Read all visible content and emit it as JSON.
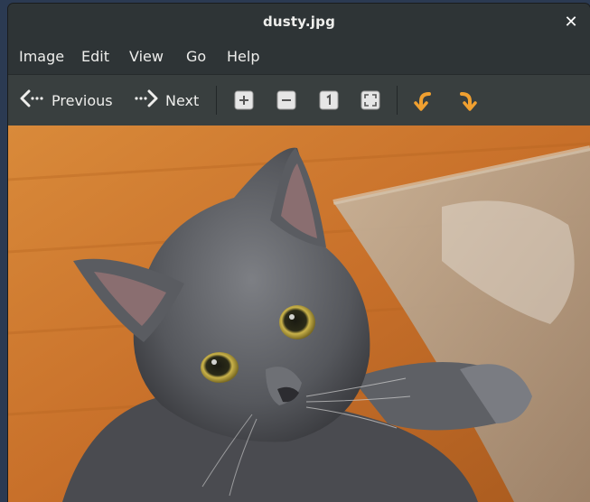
{
  "window": {
    "title": "dusty.jpg"
  },
  "menubar": {
    "items": [
      "Image",
      "Edit",
      "View",
      "Go",
      "Help"
    ]
  },
  "toolbar": {
    "previous_label": "Previous",
    "next_label": "Next",
    "icons": [
      "zoom-in-icon",
      "zoom-out-icon",
      "normal-size-icon",
      "best-fit-icon",
      "rotate-left-icon",
      "rotate-right-icon"
    ]
  },
  "image": {
    "subject": "photo of a gray cat on a wooden floor"
  },
  "colors": {
    "titlebar": "#2e3436",
    "toolbar": "#393f3f",
    "accent_rotate": "#f0a030"
  }
}
